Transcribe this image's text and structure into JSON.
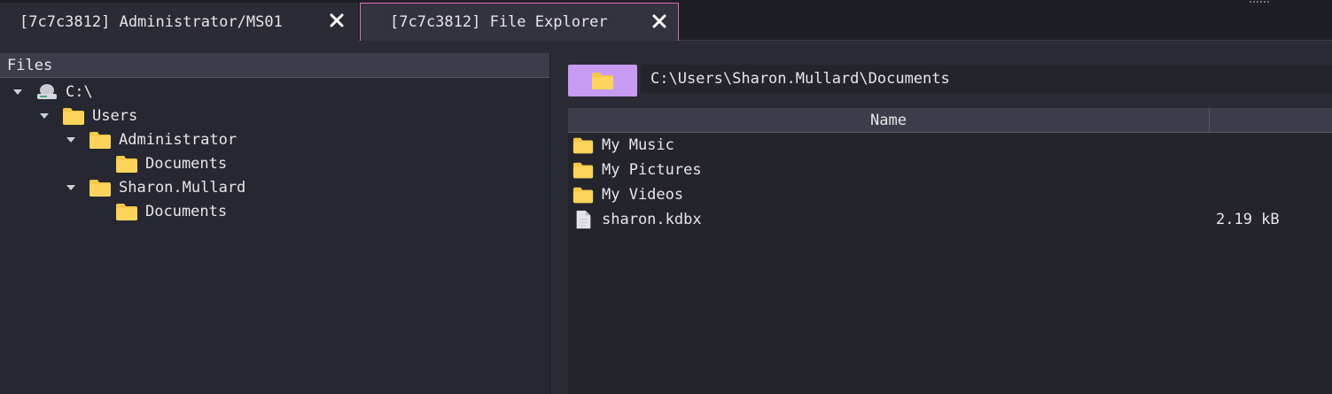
{
  "tabs": [
    {
      "label": "[7c7c3812] Administrator/MS01",
      "active": false
    },
    {
      "label": "[7c7c3812] File Explorer",
      "active": true
    }
  ],
  "colors": {
    "accent_tab_border": "#e06ab4",
    "path_button": "#c79bf2",
    "folder": "#f7c94a"
  },
  "tree": {
    "header": "Files",
    "nodes": [
      {
        "label": "C:\\",
        "icon": "drive-icon",
        "expanded": true
      },
      {
        "label": "Users",
        "icon": "folder-icon",
        "expanded": true
      },
      {
        "label": "Administrator",
        "icon": "folder-icon",
        "expanded": true
      },
      {
        "label": "Documents",
        "icon": "folder-icon",
        "expanded": false
      },
      {
        "label": "Sharon.Mullard",
        "icon": "folder-icon",
        "expanded": true
      },
      {
        "label": "Documents",
        "icon": "folder-icon",
        "expanded": false
      }
    ]
  },
  "explorer": {
    "path": "C:\\Users\\Sharon.Mullard\\Documents",
    "columns": {
      "name": "Name",
      "size": ""
    },
    "rows": [
      {
        "name": "My Music",
        "size": "",
        "icon": "folder-icon"
      },
      {
        "name": "My Pictures",
        "size": "",
        "icon": "folder-icon"
      },
      {
        "name": "My Videos",
        "size": "",
        "icon": "folder-icon"
      },
      {
        "name": "sharon.kdbx",
        "size": "2.19 kB",
        "icon": "file-icon"
      }
    ]
  }
}
